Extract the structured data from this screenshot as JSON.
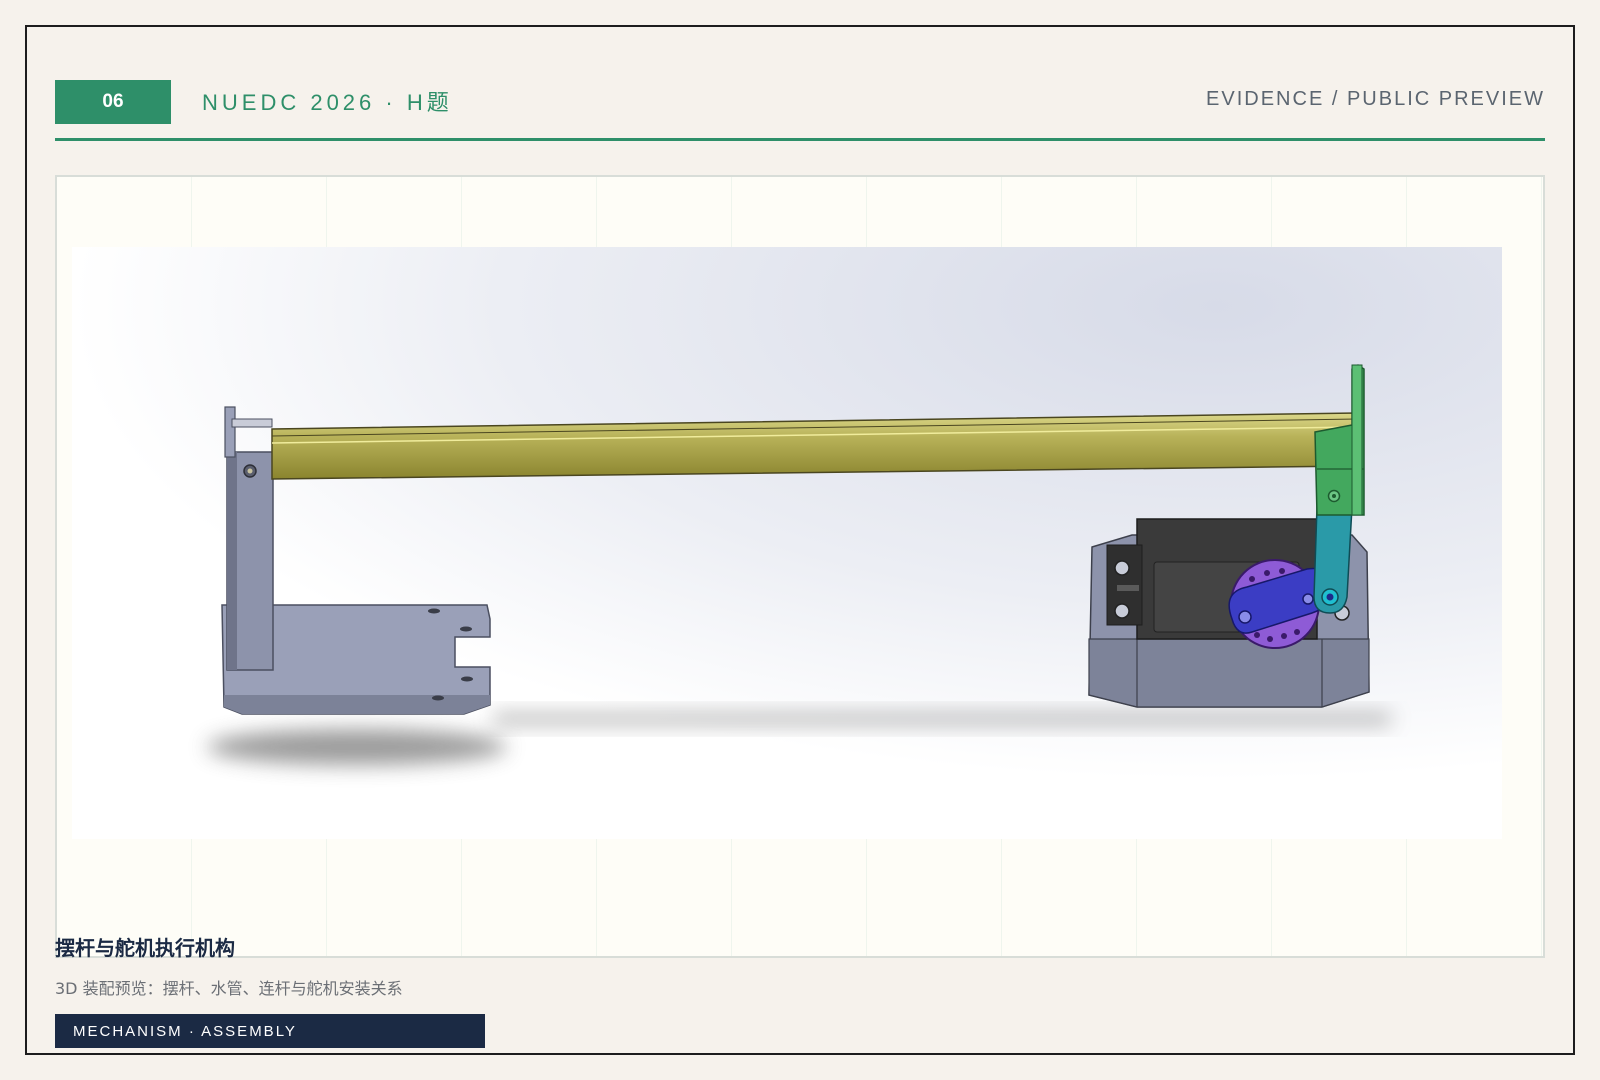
{
  "header": {
    "slide_number": "06",
    "title": "NUEDC 2026 · H题",
    "right_label": "EVIDENCE / PUBLIC PREVIEW"
  },
  "figure": {
    "caption_title": "摆杆与舵机执行机构",
    "caption_subtitle": "3D 装配预览：摆杆、水管、连杆与舵机安装关系",
    "tag": "MECHANISM · ASSEMBLY"
  },
  "colors": {
    "accent": "#2e8f69",
    "navy": "#1b2a44",
    "background": "#f6f2ec",
    "rod": "#b8b25a",
    "bracket": "#8d93ab",
    "servo_body": "#3a3a3a",
    "servo_horn": "#8e5bd6",
    "link_arm": "#2a9aa8",
    "clamp": "#43a85e",
    "lever": "#3b3dc4"
  }
}
